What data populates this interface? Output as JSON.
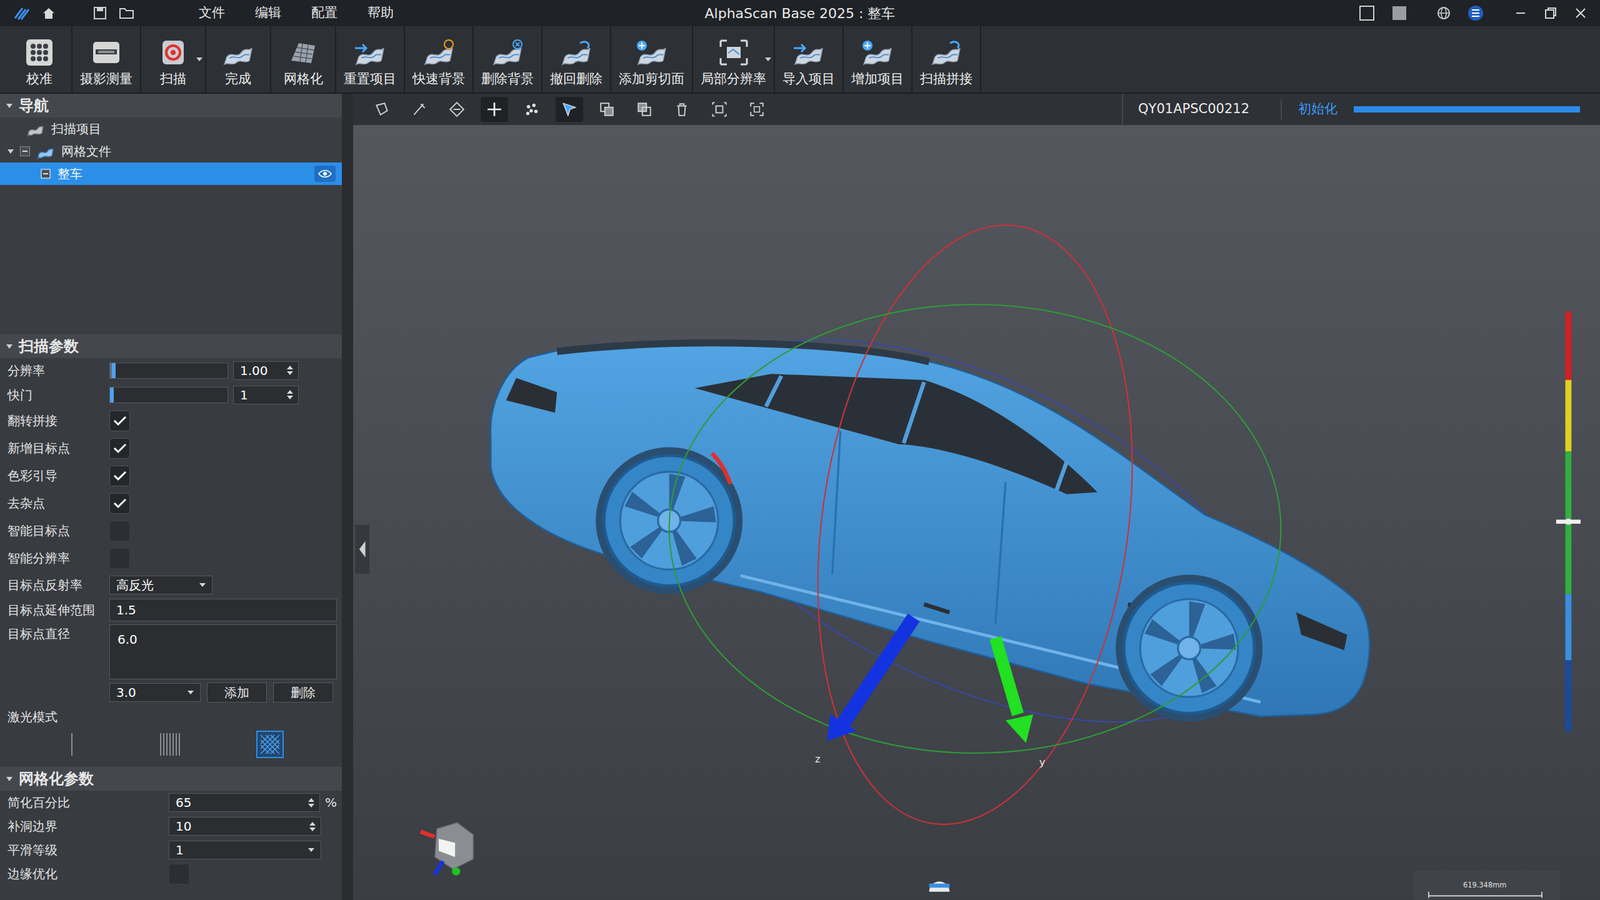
{
  "window": {
    "title": "AlphaScan Base 2025 : 整车",
    "menus": [
      "文件",
      "编辑",
      "配置",
      "帮助"
    ]
  },
  "toolbar": [
    {
      "label": "校准",
      "dropdown": false
    },
    {
      "label": "摄影测量",
      "dropdown": false
    },
    {
      "label": "扫描",
      "dropdown": true
    },
    {
      "label": "完成",
      "dropdown": false
    },
    {
      "label": "网格化",
      "dropdown": false
    },
    {
      "label": "重置项目",
      "dropdown": false
    },
    {
      "label": "快速背景",
      "dropdown": false
    },
    {
      "label": "删除背景",
      "dropdown": false
    },
    {
      "label": "撤回删除",
      "dropdown": false
    },
    {
      "label": "添加剪切面",
      "dropdown": false
    },
    {
      "label": "局部分辨率",
      "dropdown": true
    },
    {
      "label": "导入项目",
      "dropdown": false
    },
    {
      "label": "增加项目",
      "dropdown": false
    },
    {
      "label": "扫描拼接",
      "dropdown": false
    }
  ],
  "navigation": {
    "title": "导航",
    "items": [
      {
        "label": "扫描项目",
        "selected": false
      },
      {
        "label": "网格文件",
        "selected": false,
        "expanded": true,
        "children": [
          {
            "label": "整车",
            "selected": true,
            "visible": true
          }
        ]
      }
    ]
  },
  "scan_params": {
    "title": "扫描参数",
    "rows": [
      {
        "kind": "slider",
        "label": "分辨率",
        "level": 0.05,
        "value": "1.00"
      },
      {
        "kind": "slider",
        "label": "快门",
        "level": 0.01,
        "value": "1"
      },
      {
        "kind": "checkbox",
        "label": "翻转拼接",
        "checked": true
      },
      {
        "kind": "checkbox",
        "label": "新增目标点",
        "checked": true
      },
      {
        "kind": "checkbox",
        "label": "色彩引导",
        "checked": true
      },
      {
        "kind": "checkbox",
        "label": "去杂点",
        "checked": true
      },
      {
        "kind": "checkbox",
        "label": "智能目标点",
        "checked": false
      },
      {
        "kind": "checkbox",
        "label": "智能分辨率",
        "checked": false
      },
      {
        "kind": "select",
        "label": "目标点反射率",
        "value": "高反光"
      },
      {
        "kind": "text",
        "label": "目标点延伸范围",
        "value": "1.5"
      },
      {
        "kind": "list",
        "label": "目标点直径",
        "value": "6.0",
        "select": "3.0",
        "buttons": [
          "添加",
          "删除"
        ]
      },
      {
        "kind": "laser",
        "label": "激光模式",
        "options": [
          {
            "selected": false
          },
          {
            "selected": false
          },
          {
            "selected": true
          }
        ]
      }
    ]
  },
  "mesh_params": {
    "title": "网格化参数",
    "rows": [
      {
        "kind": "spin",
        "label": "简化百分比",
        "value": "65",
        "unit": "%"
      },
      {
        "kind": "spin",
        "label": "补洞边界",
        "value": "10"
      },
      {
        "kind": "select",
        "label": "平滑等级",
        "value": "1"
      },
      {
        "kind": "checkbox",
        "label": "边缘优化",
        "checked": false
      }
    ]
  },
  "viewport": {
    "tools": [
      {
        "selected": false
      },
      {
        "selected": false
      },
      {
        "selected": false
      },
      {
        "selected": true
      },
      {
        "selected": false
      },
      {
        "selected": true
      },
      {
        "selected": false
      },
      {
        "selected": false
      },
      {
        "selected": false
      },
      {
        "selected": false
      },
      {
        "selected": false
      }
    ],
    "device": "QY01APSC00212",
    "status": "初始化",
    "progress": {
      "level": 1.0
    },
    "axes": [
      "z",
      "y"
    ],
    "scale_bar": "619.348mm",
    "color_scale": {
      "level": 0.5
    }
  }
}
